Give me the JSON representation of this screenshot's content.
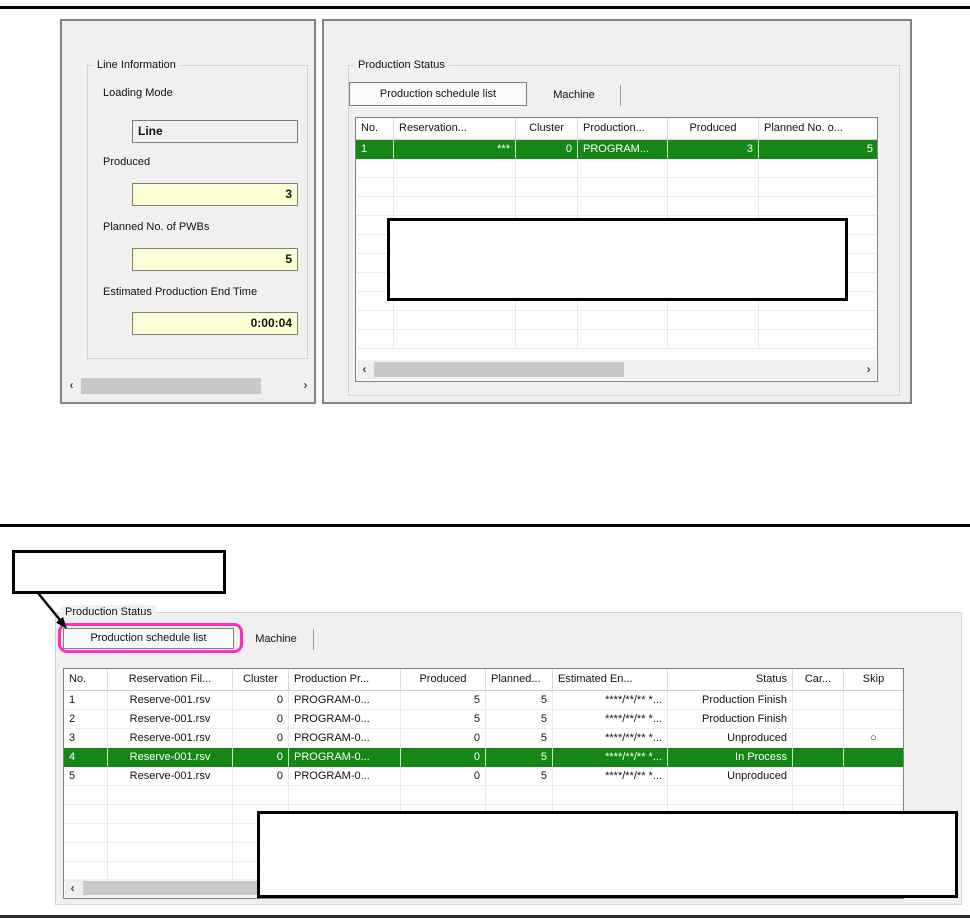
{
  "colors": {
    "selected_row_green": "#168616",
    "highlight_magenta": "#ff2dc0",
    "field_yellow": "#ffffd4",
    "panel_gray": "#f0f0f0"
  },
  "icons": {
    "scroll_left": "‹",
    "scroll_right": "›",
    "skip_mark": "○"
  },
  "top": {
    "line_info": {
      "title": "Line Information",
      "fields": [
        {
          "label": "Loading Mode",
          "value": "Line",
          "kind": "plain"
        },
        {
          "label": "Produced",
          "value": "3",
          "kind": "yellow"
        },
        {
          "label": "Planned No. of PWBs",
          "value": "5",
          "kind": "yellow"
        },
        {
          "label": "Estimated Production End Time",
          "value": "0:00:04",
          "kind": "yellow"
        }
      ]
    },
    "production_status": {
      "title": "Production Status",
      "tabs": [
        {
          "label": "Production schedule list",
          "selected": true
        },
        {
          "label": "Machine",
          "selected": false
        }
      ],
      "table": {
        "columns": [
          "No.",
          "Reservation...",
          "Cluster",
          "Production...",
          "Produced",
          "Planned No. o..."
        ],
        "rows": [
          [
            "1",
            "***",
            "0",
            "PROGRAM...",
            "3",
            "5"
          ]
        ],
        "selected_row_index": 0
      }
    }
  },
  "bottom": {
    "production_status": {
      "title": "Production Status",
      "tabs": [
        {
          "label": "Production schedule list",
          "selected": true,
          "highlighted": true
        },
        {
          "label": "Machine",
          "selected": false
        }
      ],
      "table": {
        "columns": [
          "No.",
          "Reservation Fil...",
          "Cluster",
          "Production Pr...",
          "Produced",
          "Planned...",
          "Estimated En...",
          "Status",
          "Car...",
          "Skip"
        ],
        "rows": [
          [
            "1",
            "Reserve-001.rsv",
            "0",
            "PROGRAM-0...",
            "5",
            "5",
            "****/**/** *...",
            "Production Finish",
            "",
            ""
          ],
          [
            "2",
            "Reserve-001.rsv",
            "0",
            "PROGRAM-0...",
            "5",
            "5",
            "****/**/** *...",
            "Production Finish",
            "",
            ""
          ],
          [
            "3",
            "Reserve-001.rsv",
            "0",
            "PROGRAM-0...",
            "0",
            "5",
            "****/**/** *...",
            "Unproduced",
            "",
            "○"
          ],
          [
            "4",
            "Reserve-001.rsv",
            "0",
            "PROGRAM-0...",
            "0",
            "5",
            "****/**/** *...",
            "In Process",
            "",
            ""
          ],
          [
            "5",
            "Reserve-001.rsv",
            "0",
            "PROGRAM-0...",
            "0",
            "5",
            "****/**/** *...",
            "Unproduced",
            "",
            ""
          ]
        ],
        "selected_row_index": 3
      }
    }
  }
}
